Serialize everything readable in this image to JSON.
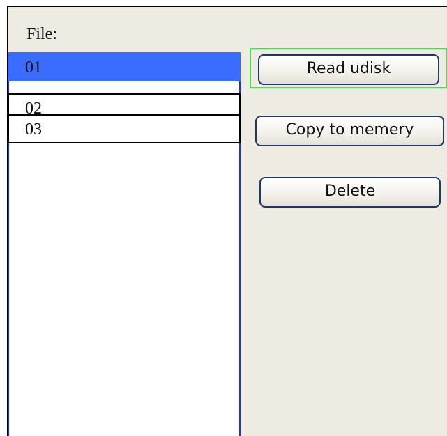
{
  "file_panel": {
    "label": "File:",
    "items": [
      "01",
      "02",
      "03"
    ],
    "selected_index": 0
  },
  "buttons": {
    "read_udisk": "Read udisk",
    "copy_to_memory": "Copy to memery",
    "delete": "Delete"
  },
  "colors": {
    "panel_background": "#eeebe2",
    "selection": "#3a6cff",
    "list_border": "#1432ff",
    "focus_ring": "#41e24f",
    "button_border": "#1f3a66"
  }
}
